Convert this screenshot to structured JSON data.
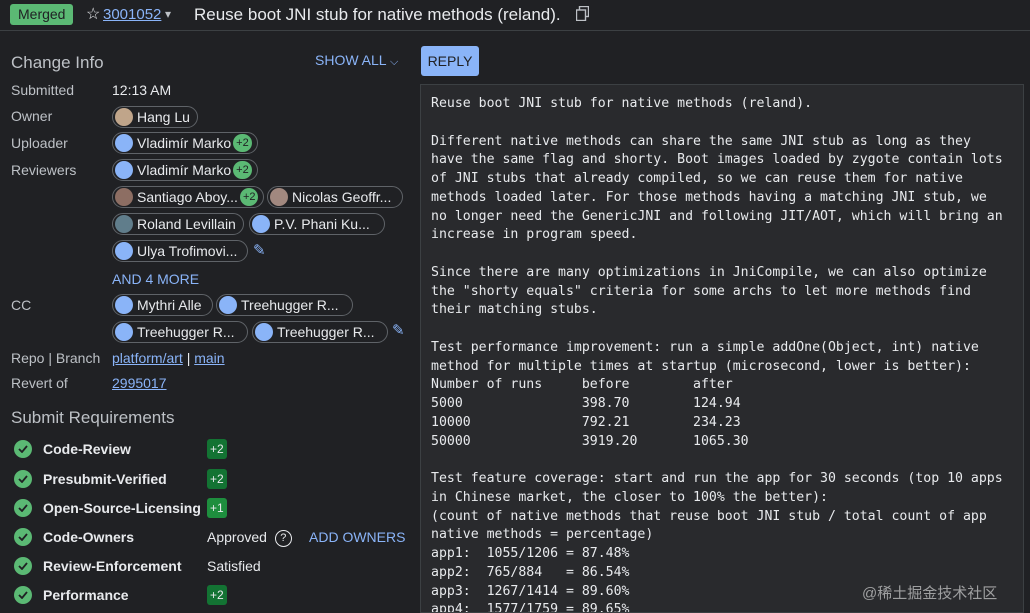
{
  "header": {
    "status_badge": "Merged",
    "star_icon": "☆",
    "change_number": "3001052",
    "caret": "▾",
    "subject": "Reuse boot JNI stub for native methods (reland)."
  },
  "change_info": {
    "title": "Change Info",
    "show_all": "SHOW ALL",
    "submitted_label": "Submitted",
    "submitted_value": "12:13 AM",
    "owner_label": "Owner",
    "owner": "Hang Lu",
    "uploader_label": "Uploader",
    "uploader": "Vladimír Marko",
    "uploader_badge": "+2",
    "reviewers_label": "Reviewers",
    "reviewers": [
      {
        "name": "Vladimír Marko",
        "badge": "+2"
      },
      {
        "name": "Santiago Aboy...",
        "badge": "+2"
      },
      {
        "name": "Nicolas Geoffr..."
      },
      {
        "name": "Roland Levillain"
      },
      {
        "name": "P.V. Phani Ku..."
      },
      {
        "name": "Ulya Trofimovi..."
      }
    ],
    "and_more": "AND 4 MORE",
    "cc_label": "CC",
    "cc": [
      {
        "name": "Mythri Alle"
      },
      {
        "name": "Treehugger R..."
      },
      {
        "name": "Treehugger R..."
      },
      {
        "name": "Treehugger R..."
      }
    ],
    "repo_label": "Repo | Branch",
    "repo": "platform/art",
    "separator": "|",
    "branch": "main",
    "revert_label": "Revert of",
    "revert_value": "2995017"
  },
  "submit_requirements": {
    "title": "Submit Requirements",
    "items": [
      {
        "name": "Code-Review",
        "vote": "+2"
      },
      {
        "name": "Presubmit-Verified",
        "vote": "+2"
      },
      {
        "name": "Open-Source-Licensing",
        "vote": "+1"
      },
      {
        "name": "Code-Owners",
        "status": "Approved",
        "help": "?",
        "action": "ADD OWNERS"
      },
      {
        "name": "Review-Enforcement",
        "status": "Satisfied"
      },
      {
        "name": "Performance",
        "vote": "+2"
      }
    ]
  },
  "reply_button": "REPLY",
  "commit_message": "Reuse boot JNI stub for native methods (reland).\n\nDifferent native methods can share the same JNI stub as long as they\nhave the same flag and shorty. Boot images loaded by zygote contain lots\nof JNI stubs that already compiled, so we can reuse them for native\nmethods loaded later. For those methods having a matching JNI stub, we\nno longer need the GenericJNI and following JIT/AOT, which will bring an\nincrease in program speed.\n\nSince there are many optimizations in JniCompile, we can also optimize\nthe \"shorty equals\" criteria for some archs to let more methods find\ntheir matching stubs.\n\nTest performance improvement: run a simple addOne(Object, int) native\nmethod for multiple times at startup (microsecond, lower is better):\nNumber of runs     before        after\n5000               398.70        124.94\n10000              792.21        234.23\n50000              3919.20       1065.30\n\nTest feature coverage: start and run the app for 30 seconds (top 10 apps\nin Chinese market, the closer to 100% the better):\n(count of native methods that reuse boot JNI stub / total count of app\nnative methods = percentage)\napp1:  1055/1206 = 87.48%\napp2:  765/884   = 86.54%\napp3:  1267/1414 = 89.60%\napp4:  1577/1759 = 89.65%",
  "watermark": "@稀土掘金技术社区"
}
